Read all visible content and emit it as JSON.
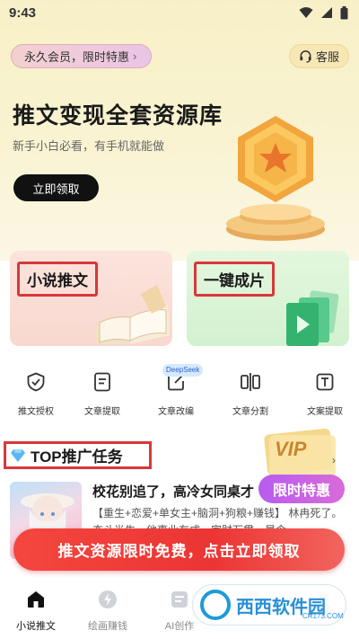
{
  "status_bar": {
    "time": "9:43"
  },
  "hero": {
    "vip_pill": "永久会员，限时特惠",
    "service": "客服",
    "title": "推文变现全套资源库",
    "subtitle": "新手小白必看，有手机就能做",
    "claim_button": "立即领取"
  },
  "cards": [
    {
      "label": "小说推文"
    },
    {
      "label": "一键成片"
    }
  ],
  "tools": {
    "items": [
      {
        "label": "推文授权",
        "icon": "shield-check-icon"
      },
      {
        "label": "文章提取",
        "icon": "document-icon"
      },
      {
        "label": "文章改编",
        "icon": "edit-icon"
      },
      {
        "label": "文章分割",
        "icon": "split-icon"
      },
      {
        "label": "文案提取",
        "icon": "text-icon"
      }
    ],
    "deepseek_badge": "DeepSeek"
  },
  "section": {
    "title": "TOP推广任务",
    "vip_text": "VIP",
    "limit_tag": "限时特惠",
    "more": "›"
  },
  "article": {
    "title": "校花别追了，高冷女同桌才",
    "desc": "【重生+恋爱+单女主+脑洞+狗粮+赚钱】 林冉死了。奋斗半生，他事业有成，家财万贯，晨令..."
  },
  "promo_banner": "推文资源限时免费，点击立即领取",
  "tabbar": {
    "tabs": [
      {
        "label": "小说推文",
        "icon": "home-icon",
        "active": true
      },
      {
        "label": "绘画赚钱",
        "icon": "bolt-icon",
        "active": false
      },
      {
        "label": "AI创作",
        "icon": "ai-icon",
        "active": false
      },
      {
        "label": "",
        "icon": "tab-icon",
        "active": false
      },
      {
        "label": "",
        "icon": "profile-icon",
        "active": false
      }
    ]
  },
  "watermark": {
    "text": "西西软件园",
    "sub": "CR173.COM"
  },
  "colors": {
    "accent_red": "#d8383a",
    "promo_red": "#ec3533",
    "hero_bg": "#f7f0c7",
    "limit_purple": "#c063e6"
  }
}
